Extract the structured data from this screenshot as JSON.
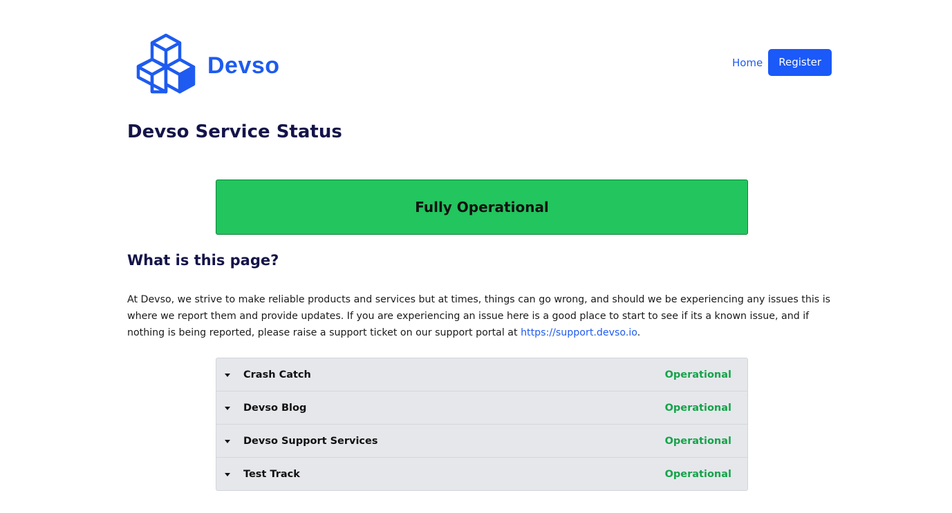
{
  "brand": {
    "name": "Devso",
    "logo_icon": "stacked-cubes-icon",
    "color": "#1e5bf0"
  },
  "nav": {
    "home_label": "Home",
    "register_label": "Register"
  },
  "page": {
    "title": "Devso Service Status"
  },
  "overall_status": {
    "label": "Fully Operational",
    "color": "#22c55e"
  },
  "about": {
    "heading": "What is this page?",
    "text": "At Devso, we strive to make reliable products and services but at times, things can go wrong, and should we be experiencing any issues this is where we report them and provide updates. If you are experiencing an issue here is a good place to start to see if its a known issue, and if nothing is being reported, please raise a support ticket on our support portal at ",
    "link_text": "https://support.devso.io",
    "suffix": "."
  },
  "services": {
    "items": [
      {
        "name": "Crash Catch",
        "status": "Operational"
      },
      {
        "name": "Devso Blog",
        "status": "Operational"
      },
      {
        "name": "Devso Support Services",
        "status": "Operational"
      },
      {
        "name": "Test Track",
        "status": "Operational"
      }
    ],
    "status_color": "#16a34a"
  }
}
